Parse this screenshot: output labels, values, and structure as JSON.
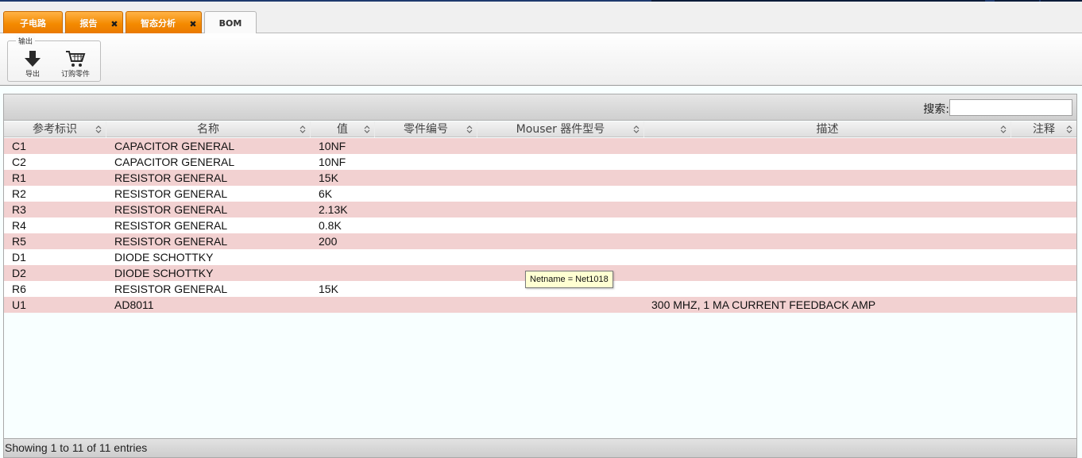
{
  "tabs": [
    {
      "label": "子电路",
      "closable": false,
      "active": false
    },
    {
      "label": "报告",
      "closable": true,
      "active": false
    },
    {
      "label": "智态分析",
      "closable": true,
      "active": false
    },
    {
      "label": "BOM",
      "closable": false,
      "active": true
    }
  ],
  "ribbon": {
    "group_title": "输出",
    "export_label": "导出",
    "order_label": "订购零件"
  },
  "search": {
    "label": "搜索:",
    "value": ""
  },
  "columns": [
    {
      "label": "参考标识"
    },
    {
      "label": "名称"
    },
    {
      "label": "值"
    },
    {
      "label": "零件编号"
    },
    {
      "label": "Mouser 器件型号"
    },
    {
      "label": "描述"
    },
    {
      "label": "注释"
    }
  ],
  "rows": [
    {
      "ref": "C1",
      "name": "CAPACITOR GENERAL",
      "value": "10NF",
      "part": "",
      "mouser": "",
      "desc": "",
      "note": ""
    },
    {
      "ref": "C2",
      "name": "CAPACITOR GENERAL",
      "value": "10NF",
      "part": "",
      "mouser": "",
      "desc": "",
      "note": ""
    },
    {
      "ref": "R1",
      "name": "RESISTOR GENERAL",
      "value": "15K",
      "part": "",
      "mouser": "",
      "desc": "",
      "note": ""
    },
    {
      "ref": "R2",
      "name": "RESISTOR GENERAL",
      "value": "6K",
      "part": "",
      "mouser": "",
      "desc": "",
      "note": ""
    },
    {
      "ref": "R3",
      "name": "RESISTOR GENERAL",
      "value": "2.13K",
      "part": "",
      "mouser": "",
      "desc": "",
      "note": ""
    },
    {
      "ref": "R4",
      "name": "RESISTOR GENERAL",
      "value": "0.8K",
      "part": "",
      "mouser": "",
      "desc": "",
      "note": ""
    },
    {
      "ref": "R5",
      "name": "RESISTOR GENERAL",
      "value": "200",
      "part": "",
      "mouser": "",
      "desc": "",
      "note": ""
    },
    {
      "ref": "D1",
      "name": "DIODE SCHOTTKY",
      "value": "",
      "part": "",
      "mouser": "",
      "desc": "",
      "note": ""
    },
    {
      "ref": "D2",
      "name": "DIODE SCHOTTKY",
      "value": "",
      "part": "",
      "mouser": "",
      "desc": "",
      "note": ""
    },
    {
      "ref": "R6",
      "name": "RESISTOR GENERAL",
      "value": "15K",
      "part": "",
      "mouser": "",
      "desc": "",
      "note": ""
    },
    {
      "ref": "U1",
      "name": "AD8011",
      "value": "",
      "part": "",
      "mouser": "",
      "desc": "300 MHZ, 1 MA CURRENT FEEDBACK AMP",
      "note": ""
    }
  ],
  "tooltip": {
    "text": "Netname = Net1018"
  },
  "footer": {
    "text": "Showing 1 to 11 of 11 entries"
  },
  "colors": {
    "tab_orange": "#f48a00",
    "row_odd": "#f2d1d1",
    "row_even": "#ffffff",
    "tooltip_bg": "#ffffd2"
  }
}
